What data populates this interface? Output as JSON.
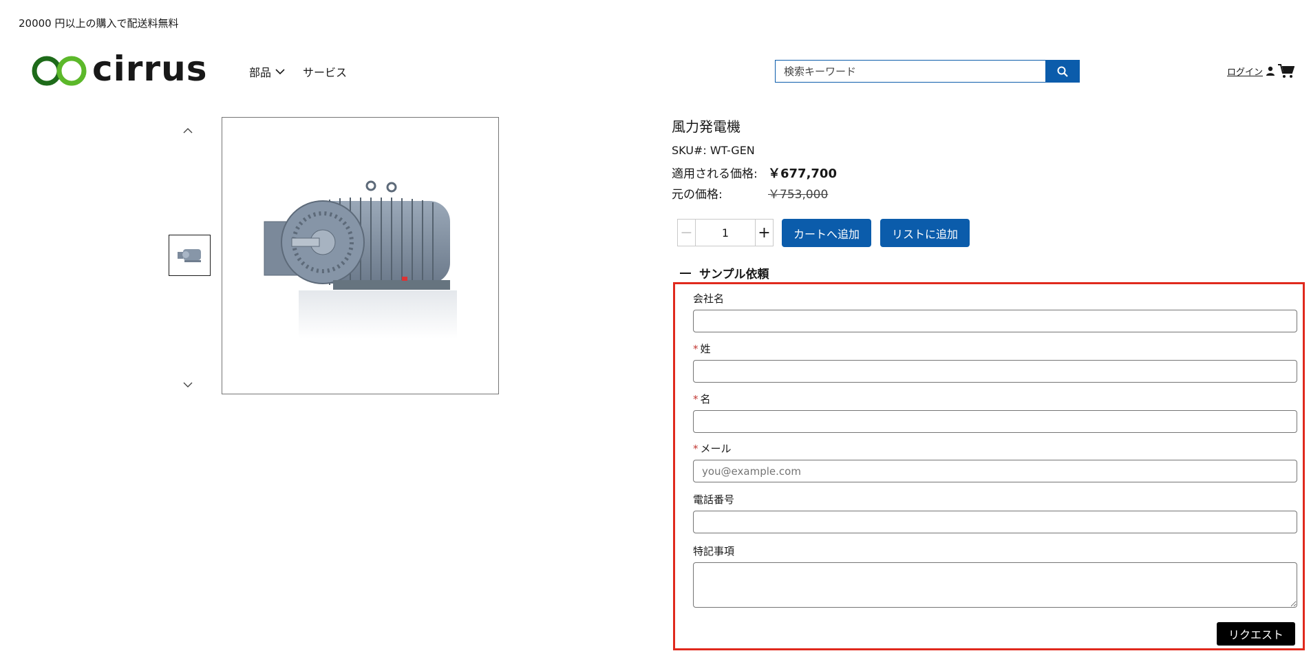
{
  "promo": {
    "text": "20000 円以上の購入で配送料無料"
  },
  "header": {
    "logo_text": "cirrus",
    "nav": [
      {
        "label": "部品",
        "has_dropdown": true
      },
      {
        "label": "サービス",
        "has_dropdown": false
      }
    ],
    "search": {
      "placeholder": "検索キーワード",
      "value": ""
    },
    "login_label": "ログイン"
  },
  "product": {
    "title": "風力発電機",
    "sku": "SKU#: WT-GEN",
    "applied_price_label": "適用される価格:",
    "applied_price": "￥677,700",
    "original_price_label": "元の価格:",
    "original_price": "￥753,000",
    "quantity": "1",
    "add_to_cart_label": "カートへ追加",
    "add_to_list_label": "リストに追加"
  },
  "sample_request": {
    "section_title": "サンプル依頼",
    "fields": {
      "company": {
        "label": "会社名",
        "required": false,
        "placeholder": ""
      },
      "last_name": {
        "label": "姓",
        "required": true,
        "placeholder": ""
      },
      "first_name": {
        "label": "名",
        "required": true,
        "placeholder": ""
      },
      "email": {
        "label": "メール",
        "required": true,
        "placeholder": "you@example.com"
      },
      "phone": {
        "label": "電話番号",
        "required": false,
        "placeholder": ""
      },
      "notes": {
        "label": "特記事項",
        "required": false,
        "placeholder": ""
      }
    },
    "submit_label": "リクエスト"
  },
  "colors": {
    "brand_blue": "#0b5cab",
    "highlight_border": "#e0291d",
    "logo_green_dark": "#1e6b1a",
    "logo_green_light": "#5cb82a"
  },
  "icons": [
    "logo-mark-icon",
    "chevron-down-icon",
    "search-icon",
    "user-icon",
    "cart-icon",
    "chevron-up-icon",
    "minus-icon",
    "plus-icon"
  ]
}
